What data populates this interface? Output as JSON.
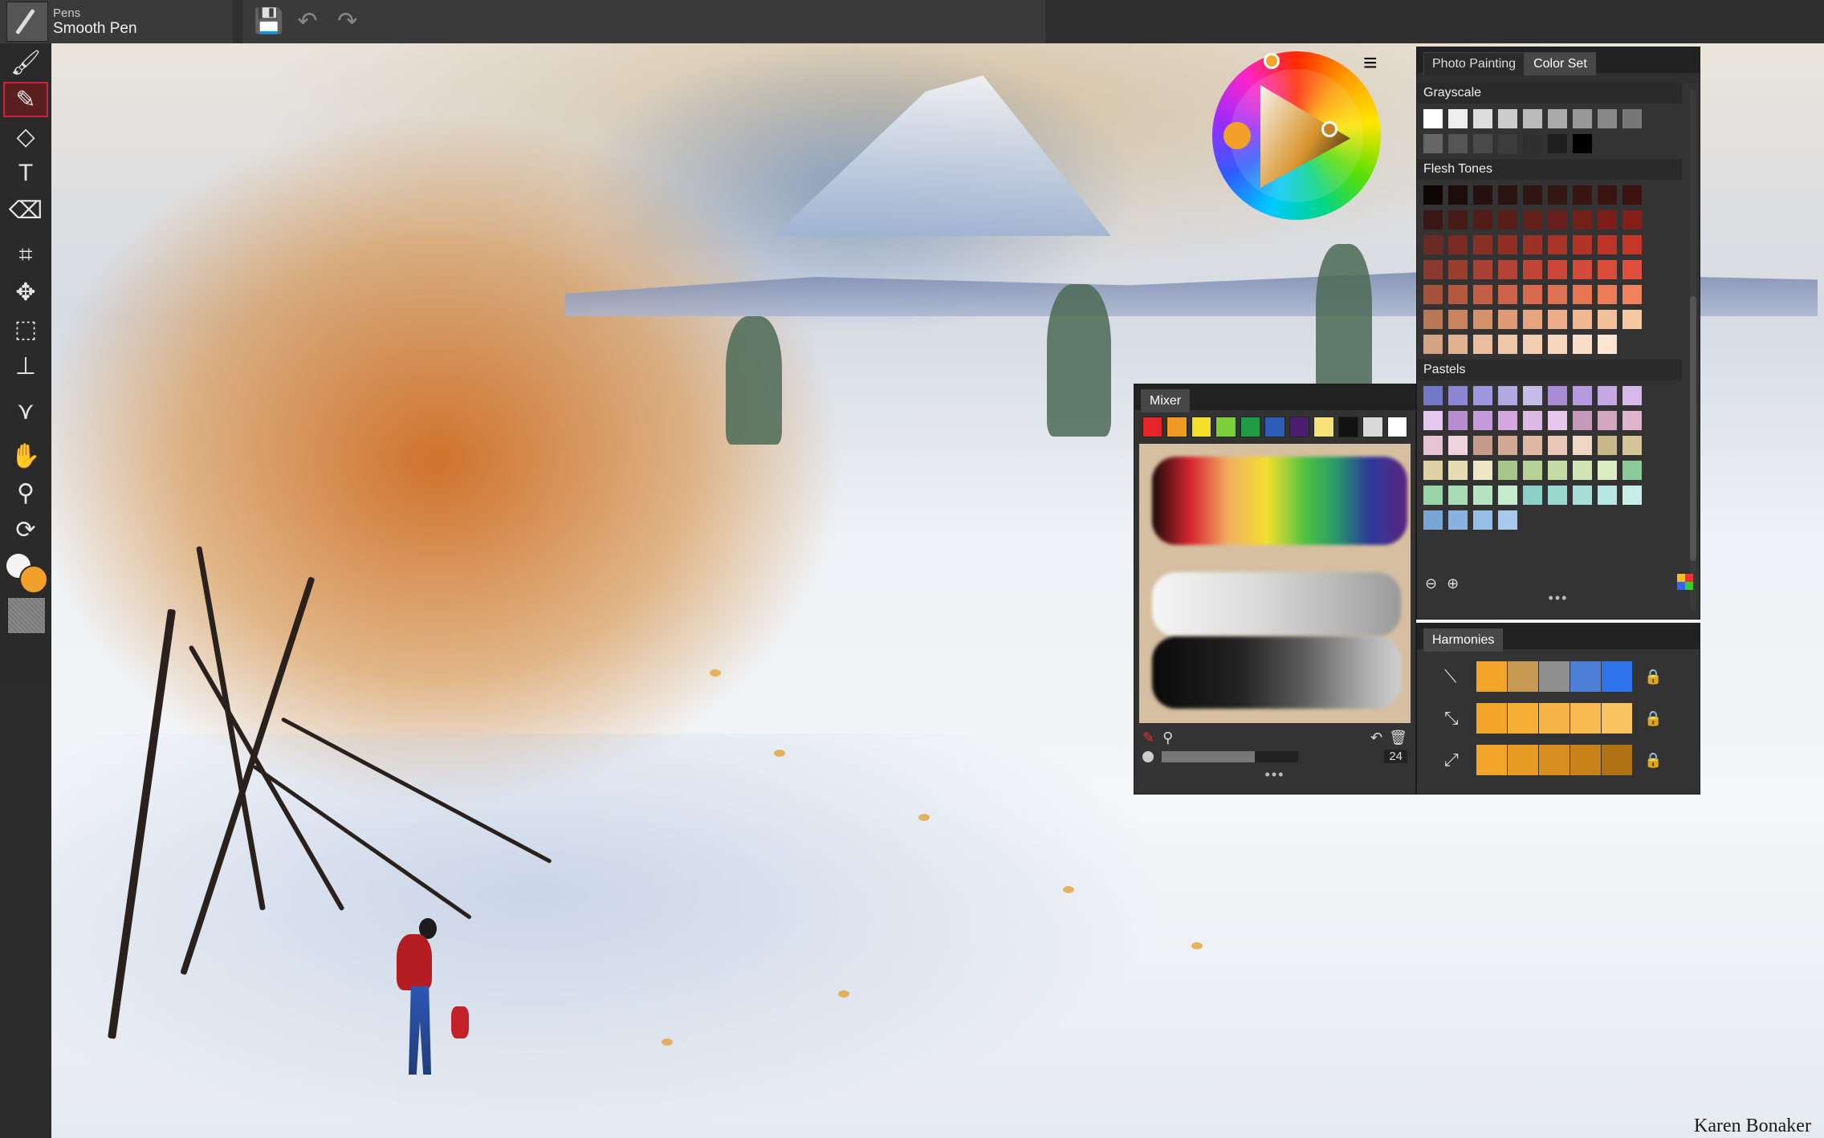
{
  "brush": {
    "category": "Pens",
    "name": "Smooth Pen"
  },
  "top_actions": [
    {
      "name": "save-icon",
      "glyph": "💾"
    },
    {
      "name": "undo-icon",
      "glyph": "↶"
    },
    {
      "name": "redo-icon",
      "glyph": "↷"
    }
  ],
  "tools": [
    {
      "name": "brush-tool",
      "glyph": "🖌",
      "active": false
    },
    {
      "name": "dropper-tool",
      "glyph": "✎",
      "active": true
    },
    {
      "name": "paint-bucket-tool",
      "glyph": "◇",
      "active": false
    },
    {
      "name": "text-tool",
      "glyph": "T",
      "active": false
    },
    {
      "name": "eraser-tool",
      "glyph": "⌫",
      "active": false
    },
    {
      "name": "crop-tool",
      "glyph": "⌗",
      "active": false
    },
    {
      "name": "transform-tool",
      "glyph": "✥",
      "active": false
    },
    {
      "name": "selection-tool",
      "glyph": "⬚",
      "active": false
    },
    {
      "name": "clone-tool",
      "glyph": "⊥",
      "active": false
    },
    {
      "name": "symmetry-tool",
      "glyph": "⋎",
      "active": false
    },
    {
      "name": "grabber-tool",
      "glyph": "✋",
      "active": false
    },
    {
      "name": "magnifier-tool",
      "glyph": "⚲",
      "active": false
    },
    {
      "name": "rotate-tool",
      "glyph": "⟳",
      "active": false
    }
  ],
  "colors": {
    "main": "#f1a12a",
    "secondary": "#f4f4f4",
    "accent_active": "#cc2244"
  },
  "wheel": {
    "menu_icon": "≡"
  },
  "color_set": {
    "tabs": [
      {
        "label": "Photo Painting",
        "active": false
      },
      {
        "label": "Color Set",
        "active": true
      }
    ],
    "sections": [
      {
        "title": "Grayscale",
        "columns": 9,
        "swatches": [
          "#ffffff",
          "#eeeeee",
          "#dddddd",
          "#cccccc",
          "#bbbbbb",
          "#aaaaaa",
          "#999999",
          "#888888",
          "#777777",
          "#666666",
          "#555555",
          "#4a4a4a",
          "#3d3d3d",
          "#2f2f2f",
          "#1f1f1f",
          "#000000"
        ]
      },
      {
        "title": "Flesh Tones",
        "columns": 9,
        "swatches": [
          "#0d0605",
          "#1c0d0a",
          "#251210",
          "#2b1512",
          "#301512",
          "#341613",
          "#381512",
          "#3a1411",
          "#3c1311",
          "#3a1714",
          "#471b16",
          "#521d18",
          "#5a1e19",
          "#631f1a",
          "#6b1f1a",
          "#742019",
          "#7c1f18",
          "#84201a",
          "#6b2a22",
          "#7a2b23",
          "#873026",
          "#912f26",
          "#9c3128",
          "#a83428",
          "#b33427",
          "#bd3528",
          "#c63628",
          "#8a3a2f",
          "#9a3e31",
          "#a84133",
          "#b54236",
          "#c14536",
          "#cb4638",
          "#d44a3b",
          "#dc4c3c",
          "#e24e3d",
          "#a5523c",
          "#b45840",
          "#c25e45",
          "#cd6348",
          "#d86a4d",
          "#e07052",
          "#e67755",
          "#eb7d59",
          "#ef835d",
          "#b97755",
          "#c88560",
          "#d4926c",
          "#de9b76",
          "#e6a57f",
          "#ecae88",
          "#f0b791",
          "#f3c09a",
          "#f6c9a3",
          "#d5a384",
          "#e0b291",
          "#e9bd9d",
          "#efc6a8",
          "#f3ceb2",
          "#f6d6bc",
          "#f9ddc6",
          "#fbe5d0"
        ]
      },
      {
        "title": "Pastels",
        "columns": 9,
        "swatches": [
          "#7279c8",
          "#8c86d4",
          "#9f97dc",
          "#b2a9e4",
          "#c6bde9",
          "#a98bd6",
          "#b59ae0",
          "#c6a8e6",
          "#d6b9ea",
          "#e3c8f0",
          "#b88cd1",
          "#c59ad8",
          "#d2a8df",
          "#dcb8e4",
          "#e6c7ea",
          "#c69ab8",
          "#d3a7c2",
          "#dfb5cd",
          "#e6c4d4",
          "#eed2dc",
          "#c69a8a",
          "#d3a996",
          "#dfb8a4",
          "#e8c8b4",
          "#f0d7c4",
          "#c8b88a",
          "#d4c596",
          "#ded1a4",
          "#e6dcb4",
          "#eee6c4",
          "#a9c68a",
          "#b7d196",
          "#c4dba4",
          "#d0e4b4",
          "#dcedc4",
          "#8acb9a",
          "#98d4a7",
          "#a7dcb4",
          "#b6e4c2",
          "#c6ecd0",
          "#8ad0c6",
          "#98d8cf",
          "#a7dfd8",
          "#b6e6e0",
          "#c6ede8",
          "#7aa6d6",
          "#89b2de",
          "#98bee5",
          "#a8c9ec"
        ]
      }
    ],
    "zoom_out_icon": "zoom-out-icon",
    "zoom_in_icon": "zoom-in-icon",
    "more_dots": "•••"
  },
  "mixer": {
    "tab": "Mixer",
    "swatches": [
      "#e4262b",
      "#ef9a22",
      "#f3e02a",
      "#7ccf3b",
      "#1f9b46",
      "#2e5db8",
      "#4a1d6e",
      "#f6e27a",
      "#111111",
      "#d9d9d9",
      "#ffffff"
    ],
    "brush_size": "24",
    "more_dots": "•••"
  },
  "harmonies": {
    "tab": "Harmonies",
    "rows": [
      {
        "swatches": [
          "#f3a52a",
          "#c79a54",
          "#8f8f8f",
          "#4d7fd6",
          "#2e73ea"
        ]
      },
      {
        "swatches": [
          "#f3a52a",
          "#f4ad35",
          "#f6b444",
          "#f7bb52",
          "#f9c363"
        ]
      },
      {
        "swatches": [
          "#f3a52a",
          "#e79b24",
          "#d88f1e",
          "#c78219",
          "#b07314"
        ]
      }
    ]
  },
  "signature": "Karen Bonaker"
}
